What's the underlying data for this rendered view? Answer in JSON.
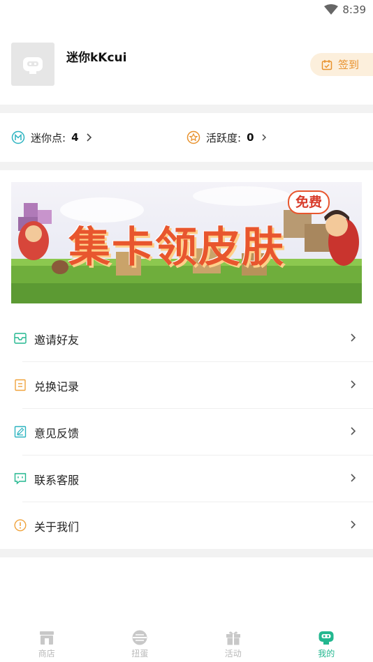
{
  "status_bar": {
    "time": "8:39"
  },
  "profile": {
    "username": "迷你kKcui",
    "checkin_label": "签到"
  },
  "stats": {
    "mini_points": {
      "label": "迷你点:",
      "value": "4"
    },
    "activity": {
      "label": "活跃度:",
      "value": "0"
    }
  },
  "banner": {
    "title": "集卡领皮肤",
    "badge": "免费"
  },
  "menu": {
    "items": [
      {
        "label": "邀请好友",
        "icon": "mail-icon",
        "color": "#22b78f"
      },
      {
        "label": "兑换记录",
        "icon": "document-icon",
        "color": "#f0a33c"
      },
      {
        "label": "意见反馈",
        "icon": "edit-icon",
        "color": "#2bb3c0"
      },
      {
        "label": "联系客服",
        "icon": "chat-icon",
        "color": "#22b78f"
      },
      {
        "label": "关于我们",
        "icon": "info-icon",
        "color": "#f0a33c"
      }
    ]
  },
  "tabs": [
    {
      "label": "商店",
      "icon": "store-icon"
    },
    {
      "label": "扭蛋",
      "icon": "capsule-icon"
    },
    {
      "label": "活动",
      "icon": "gift-icon"
    },
    {
      "label": "我的",
      "icon": "mascot-icon",
      "active": true
    }
  ],
  "colors": {
    "accent": "#22b78f",
    "orange": "#e8912c",
    "divider": "#f2f2f2"
  }
}
